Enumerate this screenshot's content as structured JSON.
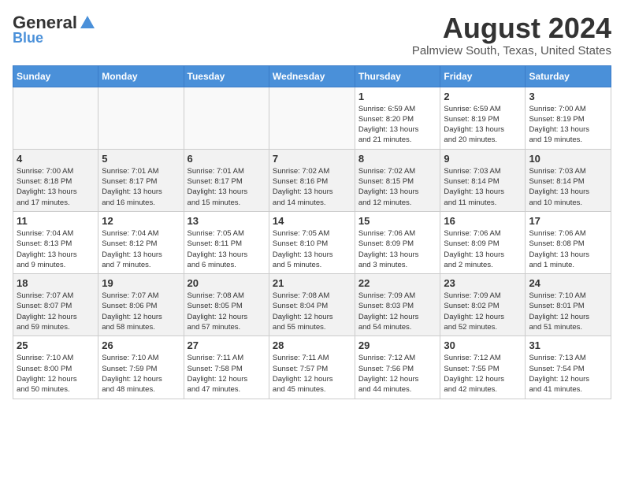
{
  "header": {
    "logo_general": "General",
    "logo_blue": "Blue",
    "month_year": "August 2024",
    "location": "Palmview South, Texas, United States"
  },
  "days_of_week": [
    "Sunday",
    "Monday",
    "Tuesday",
    "Wednesday",
    "Thursday",
    "Friday",
    "Saturday"
  ],
  "weeks": [
    {
      "days": [
        {
          "date": "",
          "info": ""
        },
        {
          "date": "",
          "info": ""
        },
        {
          "date": "",
          "info": ""
        },
        {
          "date": "",
          "info": ""
        },
        {
          "date": "1",
          "info": "Sunrise: 6:59 AM\nSunset: 8:20 PM\nDaylight: 13 hours\nand 21 minutes."
        },
        {
          "date": "2",
          "info": "Sunrise: 6:59 AM\nSunset: 8:19 PM\nDaylight: 13 hours\nand 20 minutes."
        },
        {
          "date": "3",
          "info": "Sunrise: 7:00 AM\nSunset: 8:19 PM\nDaylight: 13 hours\nand 19 minutes."
        }
      ]
    },
    {
      "days": [
        {
          "date": "4",
          "info": "Sunrise: 7:00 AM\nSunset: 8:18 PM\nDaylight: 13 hours\nand 17 minutes."
        },
        {
          "date": "5",
          "info": "Sunrise: 7:01 AM\nSunset: 8:17 PM\nDaylight: 13 hours\nand 16 minutes."
        },
        {
          "date": "6",
          "info": "Sunrise: 7:01 AM\nSunset: 8:17 PM\nDaylight: 13 hours\nand 15 minutes."
        },
        {
          "date": "7",
          "info": "Sunrise: 7:02 AM\nSunset: 8:16 PM\nDaylight: 13 hours\nand 14 minutes."
        },
        {
          "date": "8",
          "info": "Sunrise: 7:02 AM\nSunset: 8:15 PM\nDaylight: 13 hours\nand 12 minutes."
        },
        {
          "date": "9",
          "info": "Sunrise: 7:03 AM\nSunset: 8:14 PM\nDaylight: 13 hours\nand 11 minutes."
        },
        {
          "date": "10",
          "info": "Sunrise: 7:03 AM\nSunset: 8:14 PM\nDaylight: 13 hours\nand 10 minutes."
        }
      ]
    },
    {
      "days": [
        {
          "date": "11",
          "info": "Sunrise: 7:04 AM\nSunset: 8:13 PM\nDaylight: 13 hours\nand 9 minutes."
        },
        {
          "date": "12",
          "info": "Sunrise: 7:04 AM\nSunset: 8:12 PM\nDaylight: 13 hours\nand 7 minutes."
        },
        {
          "date": "13",
          "info": "Sunrise: 7:05 AM\nSunset: 8:11 PM\nDaylight: 13 hours\nand 6 minutes."
        },
        {
          "date": "14",
          "info": "Sunrise: 7:05 AM\nSunset: 8:10 PM\nDaylight: 13 hours\nand 5 minutes."
        },
        {
          "date": "15",
          "info": "Sunrise: 7:06 AM\nSunset: 8:09 PM\nDaylight: 13 hours\nand 3 minutes."
        },
        {
          "date": "16",
          "info": "Sunrise: 7:06 AM\nSunset: 8:09 PM\nDaylight: 13 hours\nand 2 minutes."
        },
        {
          "date": "17",
          "info": "Sunrise: 7:06 AM\nSunset: 8:08 PM\nDaylight: 13 hours\nand 1 minute."
        }
      ]
    },
    {
      "days": [
        {
          "date": "18",
          "info": "Sunrise: 7:07 AM\nSunset: 8:07 PM\nDaylight: 12 hours\nand 59 minutes."
        },
        {
          "date": "19",
          "info": "Sunrise: 7:07 AM\nSunset: 8:06 PM\nDaylight: 12 hours\nand 58 minutes."
        },
        {
          "date": "20",
          "info": "Sunrise: 7:08 AM\nSunset: 8:05 PM\nDaylight: 12 hours\nand 57 minutes."
        },
        {
          "date": "21",
          "info": "Sunrise: 7:08 AM\nSunset: 8:04 PM\nDaylight: 12 hours\nand 55 minutes."
        },
        {
          "date": "22",
          "info": "Sunrise: 7:09 AM\nSunset: 8:03 PM\nDaylight: 12 hours\nand 54 minutes."
        },
        {
          "date": "23",
          "info": "Sunrise: 7:09 AM\nSunset: 8:02 PM\nDaylight: 12 hours\nand 52 minutes."
        },
        {
          "date": "24",
          "info": "Sunrise: 7:10 AM\nSunset: 8:01 PM\nDaylight: 12 hours\nand 51 minutes."
        }
      ]
    },
    {
      "days": [
        {
          "date": "25",
          "info": "Sunrise: 7:10 AM\nSunset: 8:00 PM\nDaylight: 12 hours\nand 50 minutes."
        },
        {
          "date": "26",
          "info": "Sunrise: 7:10 AM\nSunset: 7:59 PM\nDaylight: 12 hours\nand 48 minutes."
        },
        {
          "date": "27",
          "info": "Sunrise: 7:11 AM\nSunset: 7:58 PM\nDaylight: 12 hours\nand 47 minutes."
        },
        {
          "date": "28",
          "info": "Sunrise: 7:11 AM\nSunset: 7:57 PM\nDaylight: 12 hours\nand 45 minutes."
        },
        {
          "date": "29",
          "info": "Sunrise: 7:12 AM\nSunset: 7:56 PM\nDaylight: 12 hours\nand 44 minutes."
        },
        {
          "date": "30",
          "info": "Sunrise: 7:12 AM\nSunset: 7:55 PM\nDaylight: 12 hours\nand 42 minutes."
        },
        {
          "date": "31",
          "info": "Sunrise: 7:13 AM\nSunset: 7:54 PM\nDaylight: 12 hours\nand 41 minutes."
        }
      ]
    }
  ]
}
